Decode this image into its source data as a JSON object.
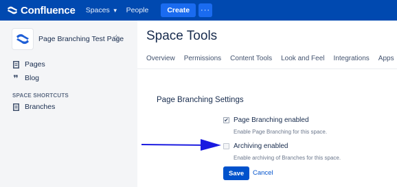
{
  "topnav": {
    "logo_text": "Confluence",
    "spaces_label": "Spaces",
    "people_label": "People",
    "create_label": "Create",
    "more_label": "···"
  },
  "sidebar": {
    "space_name": "Page Branching Test Page",
    "items": [
      {
        "label": "Pages",
        "icon": "page-icon"
      },
      {
        "label": "Blog",
        "icon": "quote-icon"
      }
    ],
    "shortcuts_heading": "SPACE SHORTCUTS",
    "shortcuts": [
      {
        "label": "Branches",
        "icon": "page-icon"
      }
    ]
  },
  "main": {
    "title": "Space Tools",
    "tabs": [
      "Overview",
      "Permissions",
      "Content Tools",
      "Look and Feel",
      "Integrations",
      "Apps"
    ],
    "section_title": "Page Branching Settings",
    "options": [
      {
        "label": "Page Branching enabled",
        "checked": true,
        "hint": "Enable Page Branching for this space."
      },
      {
        "label": "Archiving enabled",
        "checked": false,
        "hint": "Enable archiving of Branches for this space."
      }
    ],
    "save_label": "Save",
    "cancel_label": "Cancel"
  },
  "colors": {
    "nav_bg": "#0049b0",
    "create_btn": "#1a6bf0",
    "primary": "#0052cc",
    "sidebar_bg": "#f4f5f7",
    "arrow": "#1a1ae0"
  }
}
